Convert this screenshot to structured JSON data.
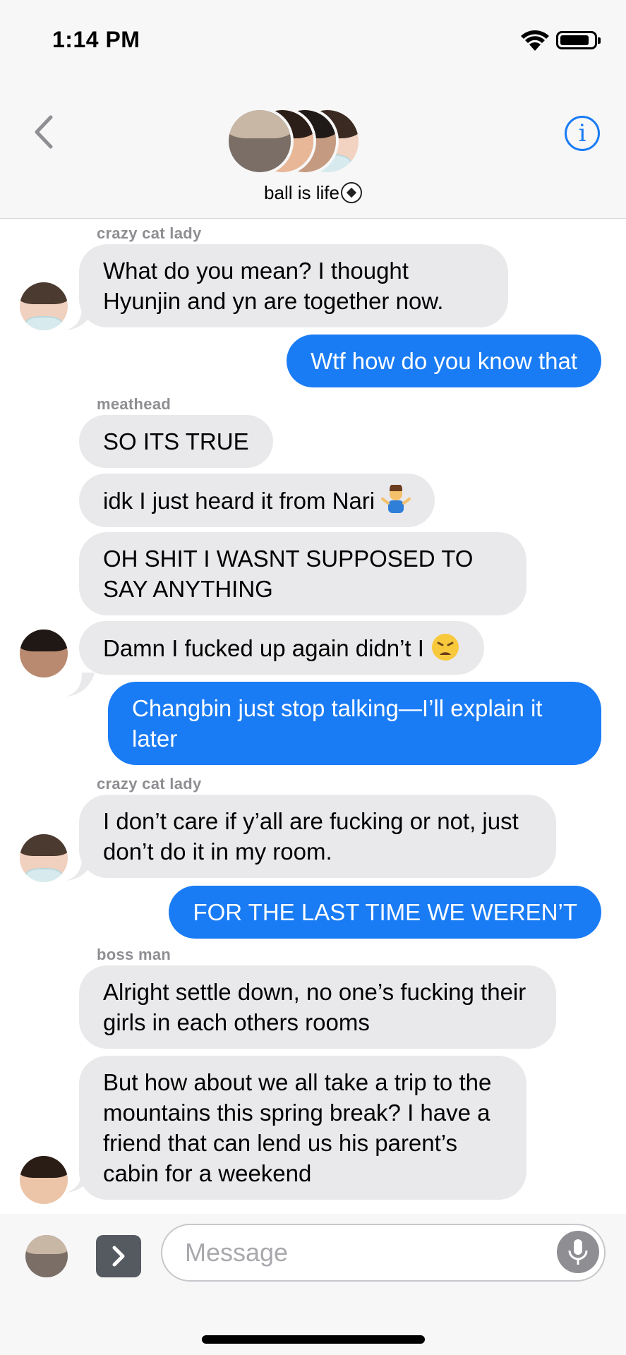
{
  "status_bar": {
    "time": "1:14 PM"
  },
  "header": {
    "group_name": "ball is life"
  },
  "messages": [
    {
      "sender": "crazy cat lady",
      "text": "What do you mean? I thought Hyunjin and yn are together now.",
      "direction": "in"
    },
    {
      "text": "Wtf how do you know that",
      "direction": "out"
    },
    {
      "sender": "meathead",
      "text": "SO ITS TRUE",
      "direction": "in"
    },
    {
      "text": "idk I just heard it from Nari",
      "emoji": "man-shrugging-icon",
      "direction": "in"
    },
    {
      "text": "OH SHIT I WASNT SUPPOSED TO SAY ANYTHING",
      "direction": "in"
    },
    {
      "text": "Damn I fucked up again didn’t I",
      "emoji": "weary-face-icon",
      "direction": "in"
    },
    {
      "text": "Changbin just stop talking—I’ll explain it later",
      "direction": "out"
    },
    {
      "sender": "crazy cat lady",
      "text": "I don’t care if y’all are fucking or not, just don’t do it in my room.",
      "direction": "in"
    },
    {
      "text": "FOR THE LAST TIME WE WEREN’T",
      "direction": "out"
    },
    {
      "sender": "boss man",
      "text": "Alright settle down, no one’s fucking their girls in each others rooms",
      "direction": "in"
    },
    {
      "text": "But how about we all take a trip to the mountains this spring break? I have a friend that can lend us his parent’s cabin for a weekend",
      "direction": "in"
    }
  ],
  "input": {
    "placeholder": "Message"
  },
  "colors": {
    "outgoing_bubble": "#1a7cf5",
    "incoming_bubble": "#e9e9eb",
    "header_bg": "#f7f7f7"
  }
}
